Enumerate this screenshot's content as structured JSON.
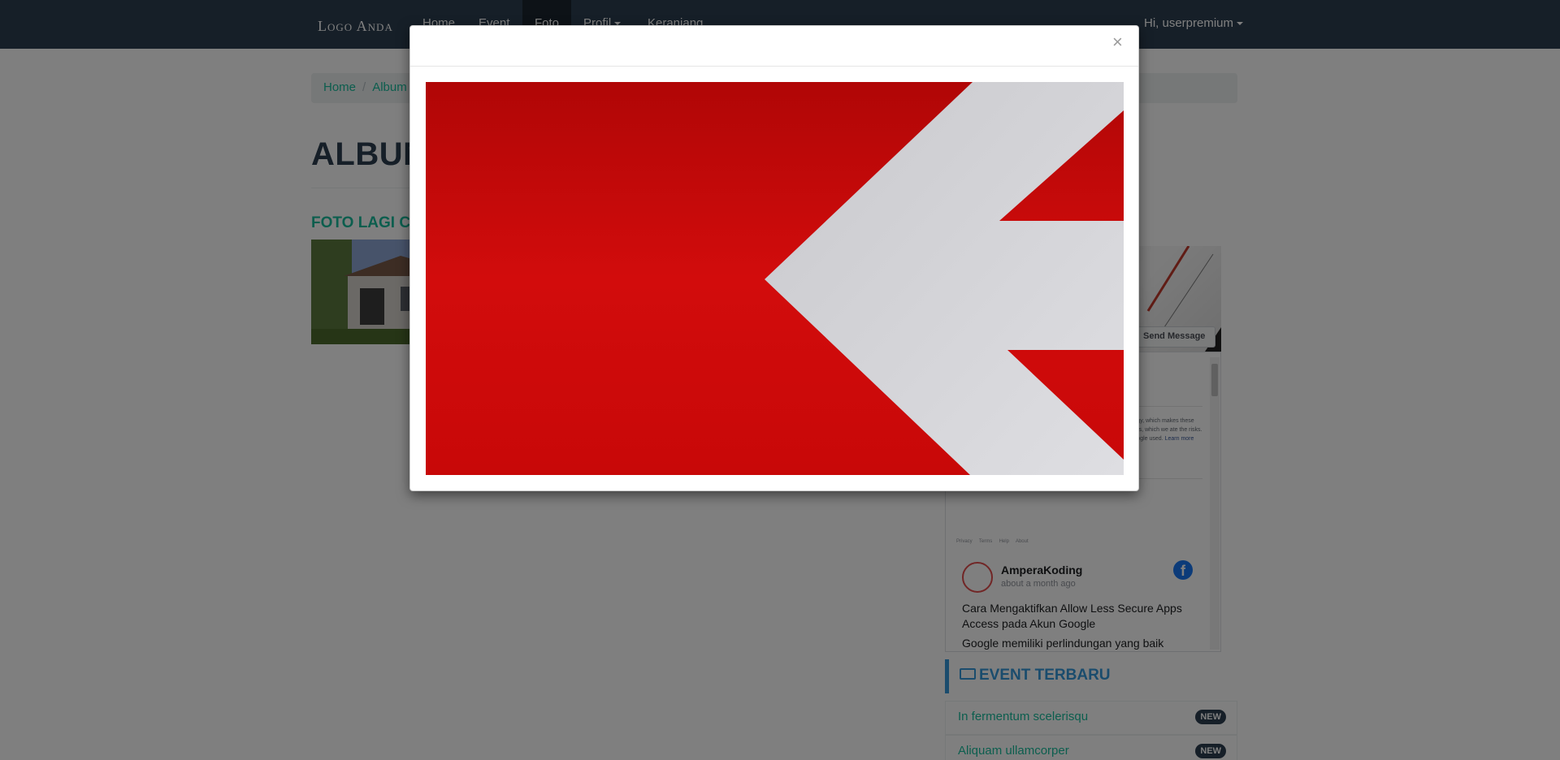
{
  "navbar": {
    "brand": "Logo Anda",
    "items": [
      {
        "label": "Home"
      },
      {
        "label": "Event"
      },
      {
        "label": "Foto"
      },
      {
        "label": "Profil"
      },
      {
        "label": "Keranjang"
      }
    ],
    "user_menu": "Hi, userpremium",
    "active_item": "Foto"
  },
  "breadcrumb": {
    "items": [
      "Home",
      "Album"
    ]
  },
  "page": {
    "heading": "ALBUM",
    "album_title": "FOTO LAGI CO"
  },
  "sidebar": {
    "fb_widget": {
      "send_message": "Send Message",
      "notice_text": "ology, which makes these apps, which we ate the risks. Google used.",
      "learn_more": "Learn more",
      "footer_links": [
        "Privacy",
        "Terms",
        "Help",
        "About"
      ],
      "post": {
        "author": "AmperaKoding",
        "time": "about a month ago",
        "title": "Cara Mengaktifkan Allow Less Secure Apps Access pada Akun Google",
        "excerpt": "Google memiliki perlindungan yang baik"
      }
    },
    "events": {
      "heading": "EVENT TERBARU",
      "items": [
        {
          "label": "In fermentum scelerisqu",
          "badge": "NEW"
        },
        {
          "label": "Aliquam ullamcorper",
          "badge": "NEW"
        }
      ]
    }
  },
  "modal": {
    "close_label": "×",
    "image": {
      "subject": "white arrow on red background",
      "colors": {
        "red": "#d10a0a",
        "white": "#d8d8dc"
      }
    }
  },
  "colors": {
    "navbar": "#2c3e50",
    "accent_teal": "#18bc9c",
    "accent_blue": "#3498db",
    "backdrop": "rgba(0,0,0,0.5)"
  }
}
